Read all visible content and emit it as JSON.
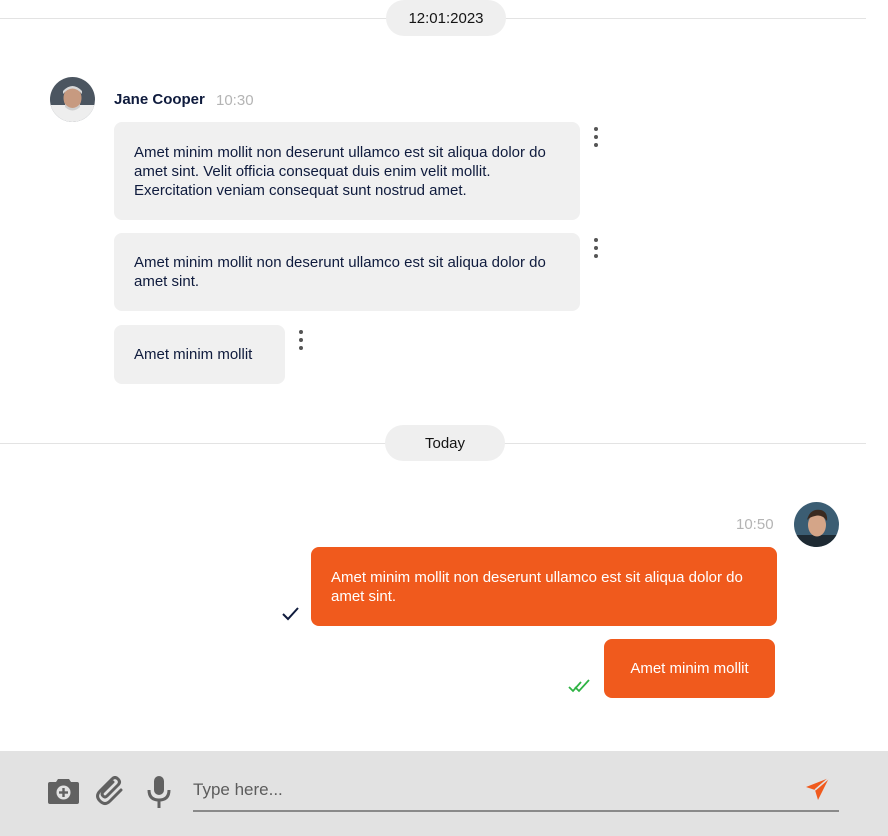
{
  "dates": {
    "first": "12:01:2023",
    "second": "Today"
  },
  "incoming": {
    "sender": "Jane Cooper",
    "time": "10:30",
    "messages": [
      "Amet minim mollit non deserunt ullamco est sit aliqua dolor do amet sint. Velit officia consequat duis enim velit mollit. Exercitation veniam consequat sunt nostrud amet.",
      "Amet minim mollit non deserunt ullamco est sit aliqua dolor do amet sint.",
      "Amet minim mollit"
    ]
  },
  "outgoing": {
    "time": "10:50",
    "messages": [
      {
        "text": "Amet minim mollit non deserunt ullamco est sit aliqua dolor do amet sint.",
        "status": "sent"
      },
      {
        "text": "Amet minim mollit",
        "status": "read"
      }
    ]
  },
  "composer": {
    "placeholder": "Type here...",
    "icons": [
      "camera-icon",
      "paperclip-icon",
      "microphone-icon",
      "send-icon"
    ]
  },
  "colors": {
    "accent": "#f05a1d",
    "read": "#2fb344",
    "text": "#0f1b3d"
  }
}
